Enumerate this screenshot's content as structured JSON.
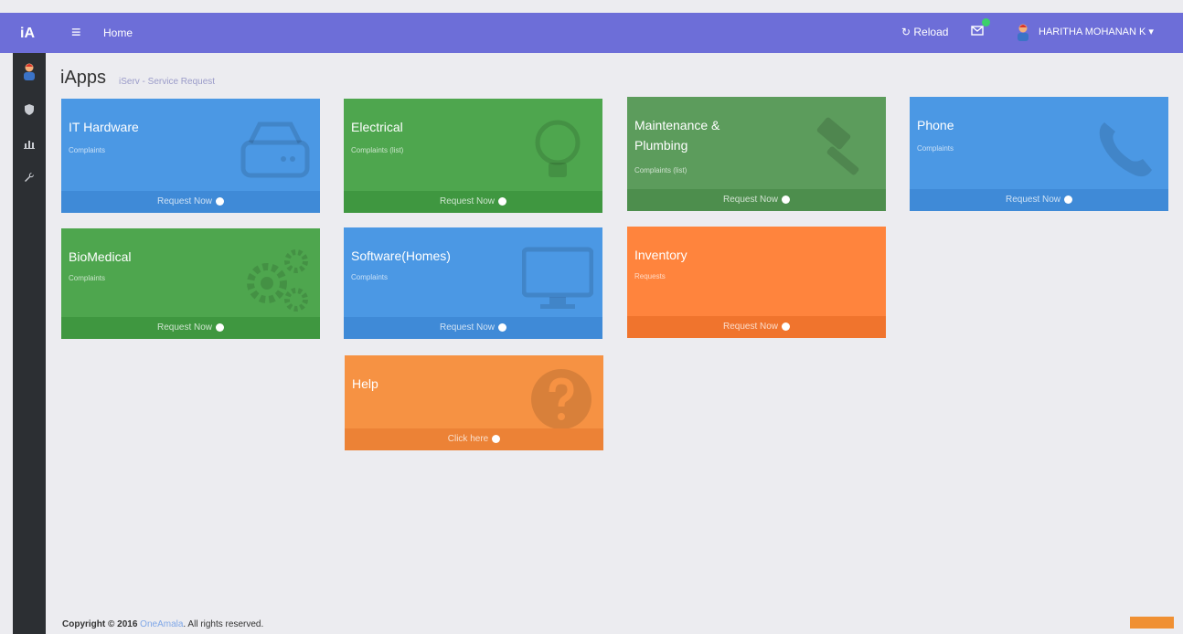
{
  "brand": "iA",
  "topbar": {
    "menu_icon": "hamburger-icon",
    "home": "Home",
    "reload": "↻ Reload",
    "mail_icon": "envelope-icon",
    "user": "HARITHA MOHANAN K ▾",
    "accent": "#6d6ed8"
  },
  "sidebar": {
    "icons": [
      "avatar-icon",
      "shield-icon",
      "chart-icon",
      "wrench-icon"
    ]
  },
  "page": {
    "title": "iApps",
    "subtitle": "iServ - Service Request"
  },
  "tiles": [
    {
      "title": "IT Hardware",
      "subtitle": "Complaints",
      "action": "Request Now",
      "icon": "hard-drive-icon",
      "color": "#4b98e4"
    },
    {
      "title": "Electrical",
      "subtitle": "Complaints (list)",
      "action": "Request Now",
      "icon": "lightbulb-icon",
      "color": "#4ea64e"
    },
    {
      "title": "Maintenance &",
      "title2": "Plumbing",
      "subtitle": "Complaints (list)",
      "action": "Request Now",
      "icon": "gavel-icon",
      "color": "#5c9c5c"
    },
    {
      "title": "Phone",
      "subtitle": "Complaints",
      "action": "Request Now",
      "icon": "phone-icon",
      "color": "#4b98e4"
    },
    {
      "title": "BioMedical",
      "subtitle": "Complaints",
      "action": "Request Now",
      "icon": "gears-icon",
      "color": "#4ea64e"
    },
    {
      "title": "Software(Homes)",
      "subtitle": "Complaints",
      "action": "Request Now",
      "icon": "monitor-icon",
      "color": "#4b98e4"
    },
    {
      "title": "Inventory",
      "subtitle": "Requests",
      "action": "Request Now",
      "icon": "",
      "color": "#ff843d"
    },
    {
      "title": "Help",
      "subtitle": "",
      "action": "Click here",
      "icon": "question-icon",
      "color": "#f69243"
    }
  ],
  "footer": {
    "copyright_prefix": "Copyright © 2016",
    "company": "OneAmala",
    "suffix": ". All rights reserved."
  }
}
